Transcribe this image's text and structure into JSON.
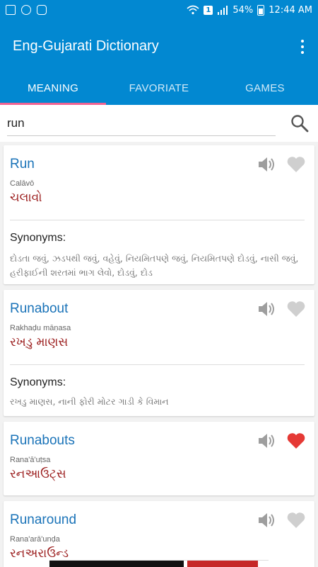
{
  "status_bar": {
    "battery": "54%",
    "time": "12:44 AM",
    "notification_badge": "1",
    "icons": [
      "gallery-icon",
      "circle-app-icon",
      "instagram-icon",
      "wifi-icon",
      "signal-icon",
      "battery-icon"
    ]
  },
  "app": {
    "title": "Eng-Gujarati Dictionary",
    "brand_color": "#0288d1",
    "tab_indicator_color": "#f06292"
  },
  "tabs": [
    {
      "label": "MEANING",
      "active": true
    },
    {
      "label": "FAVORIATE",
      "active": false
    },
    {
      "label": "GAMES",
      "active": false
    }
  ],
  "search": {
    "value": "run"
  },
  "entries": [
    {
      "word": "Run",
      "transliteration": "Calāvō",
      "gujarati": "ચલાવો",
      "favorite": false,
      "synonyms_label": "Synonyms:",
      "synonyms": "દોડતા જવું, ઝડપથી જવું, વહેવું, નિયમિતપણે જવું, નિયમિતપણે દોડવું, નાસી જવું, હરીફાઈની શરતમાં ભાગ લેવો, દોડવું, દોડ"
    },
    {
      "word": "Runabout",
      "transliteration": "Rakhaḍu māṇasa",
      "gujarati": "રખડુ માણસ",
      "favorite": false,
      "synonyms_label": "Synonyms:",
      "synonyms": "રખડુ માણસ, નાની ફોરી મોટર ગાડી કે વિમાન"
    },
    {
      "word": "Runabouts",
      "transliteration": "Rana'ā'uṭsa",
      "gujarati": "રનઆઉટ્સ",
      "favorite": true
    },
    {
      "word": "Runaround",
      "transliteration": "Rana'arā'unḍa",
      "gujarati": "રનઅરાઉન્ડ",
      "favorite": false
    }
  ],
  "colors": {
    "word": "#1a73b8",
    "gujarati": "#9b1d1d",
    "heart_active": "#e53935",
    "heart_inactive": "#cfcfcf",
    "speaker": "#9e9e9e"
  }
}
